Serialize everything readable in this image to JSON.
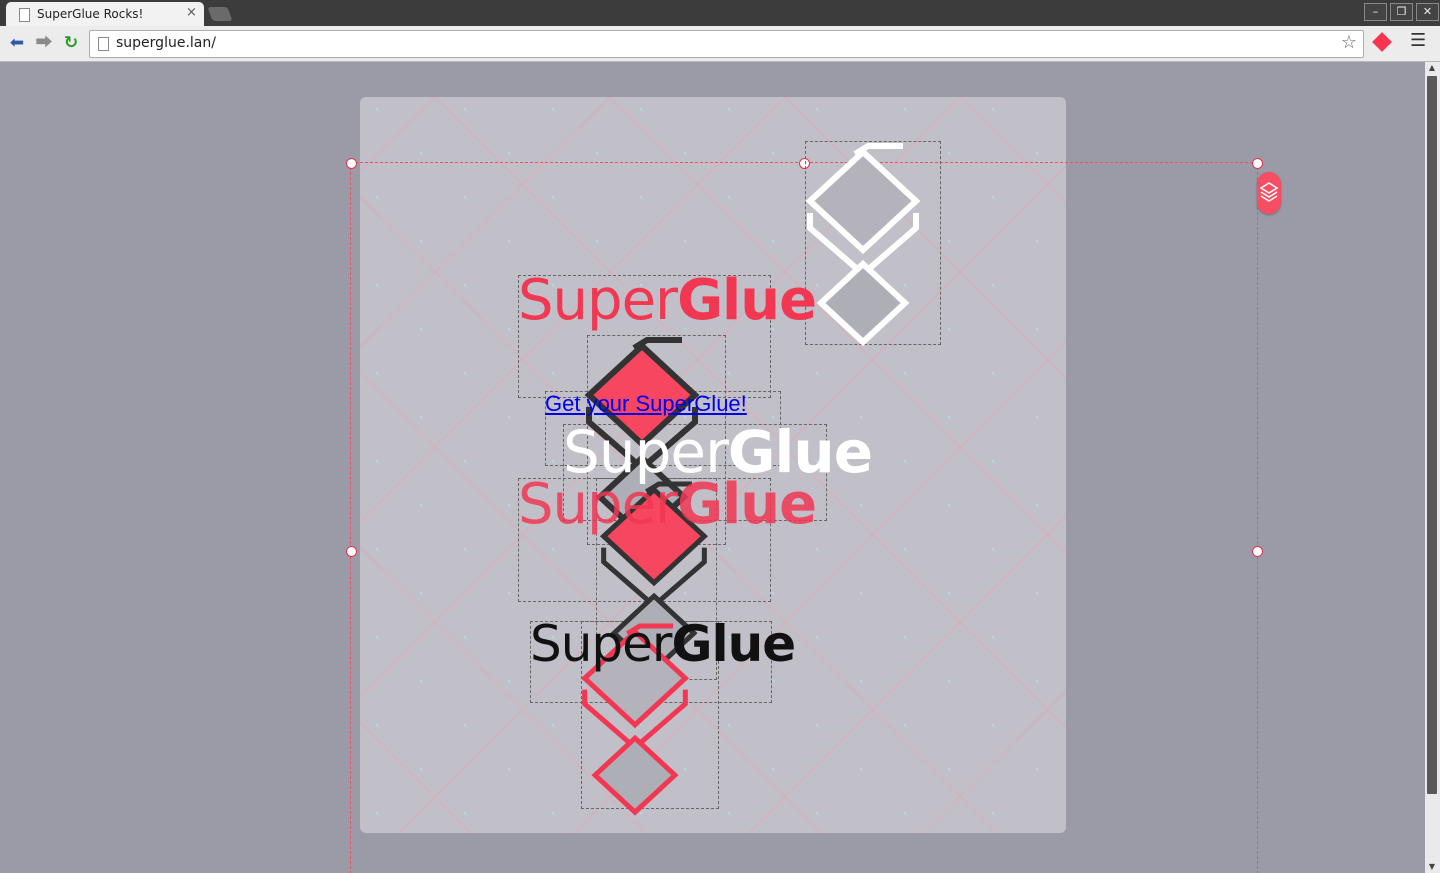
{
  "browser": {
    "tab_title": "SuperGlue Rocks!",
    "tab_close": "×",
    "url": "superglue.lan/",
    "window_buttons": [
      "–",
      "❐",
      "✕"
    ]
  },
  "page": {
    "logos": [
      {
        "light": "Super",
        "bold": "Glue",
        "color": "#f23753"
      },
      {
        "light": "Super",
        "bold": "Glue",
        "color": "#ffffff"
      },
      {
        "light": "Super",
        "bold": "Glue",
        "color": "#f23753"
      },
      {
        "light": "Super",
        "bold": "Glue",
        "color": "#111111"
      }
    ],
    "cta_link": "Get your SuperGlue!"
  },
  "colors": {
    "brand": "#f23753",
    "page_bg": "#9b9ba8",
    "canvas_bg": "#c1bfc7"
  }
}
